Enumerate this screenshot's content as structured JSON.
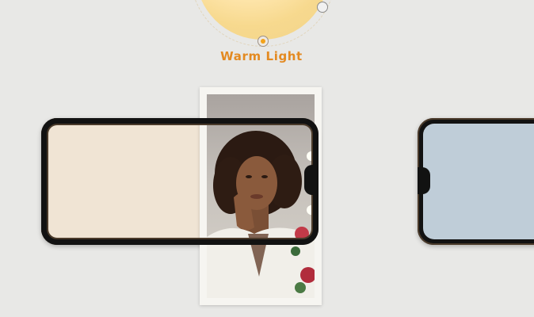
{
  "light_mode": {
    "label": "Warm Light",
    "accent_color": "#e38a22",
    "dial_color": "#f6d893"
  },
  "phones": {
    "main": {
      "screen_color": "#f0e4d4"
    },
    "right": {
      "screen_color": "#bfcdd8"
    }
  },
  "photo": {
    "subject": "portrait-photo"
  },
  "icons": {
    "dial_handle": "circle-knob-icon",
    "slider_thumb": "radio-dot-icon"
  }
}
